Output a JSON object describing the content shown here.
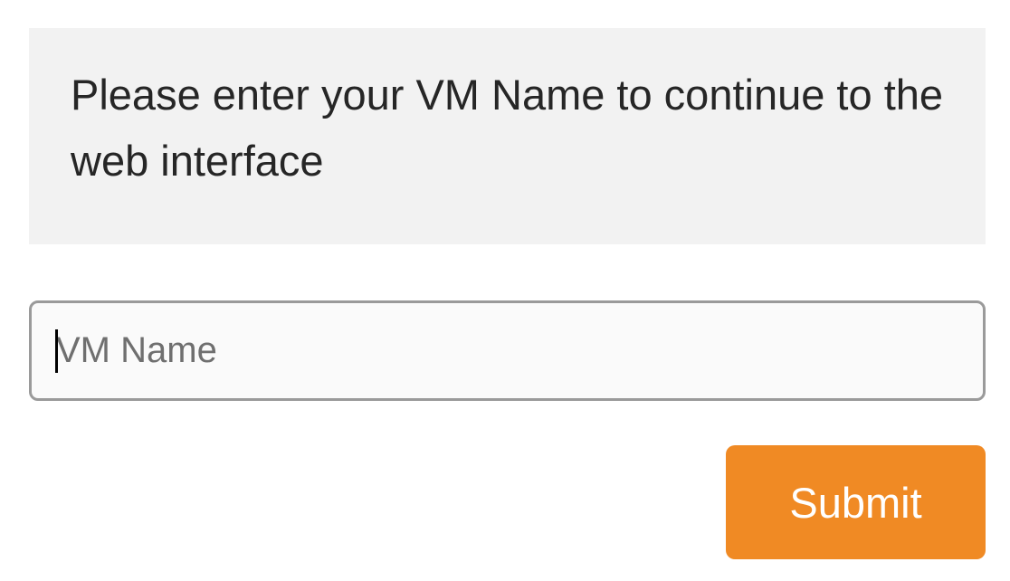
{
  "prompt": {
    "message": "Please enter your VM Name to continue to the web interface"
  },
  "form": {
    "vm_name_placeholder": "VM Name",
    "vm_name_value": "",
    "submit_label": "Submit"
  },
  "colors": {
    "accent": "#f08a24",
    "panel_background": "#f2f2f2"
  }
}
